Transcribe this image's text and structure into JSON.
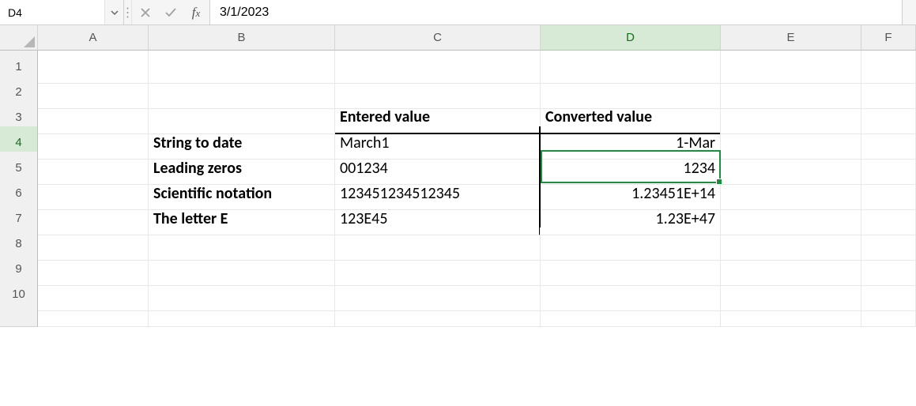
{
  "name_box": {
    "value": "D4"
  },
  "formula_bar": {
    "value": "3/1/2023"
  },
  "columns": [
    "A",
    "B",
    "C",
    "D",
    "E",
    "F"
  ],
  "rows": [
    "1",
    "2",
    "3",
    "4",
    "5",
    "6",
    "7",
    "8",
    "9",
    "10"
  ],
  "active_column": "D",
  "active_row": "4",
  "headers": {
    "entered": "Entered value",
    "converted": "Converted value"
  },
  "data": [
    {
      "label": "String to date",
      "entered": "March1",
      "converted": "1-Mar"
    },
    {
      "label": "Leading zeros",
      "entered": "001234",
      "converted": "1234"
    },
    {
      "label": "Scientific notation",
      "entered": "123451234512345",
      "converted": "1.23451E+14"
    },
    {
      "label": "The letter E",
      "entered": "123E45",
      "converted": "1.23E+47"
    }
  ]
}
